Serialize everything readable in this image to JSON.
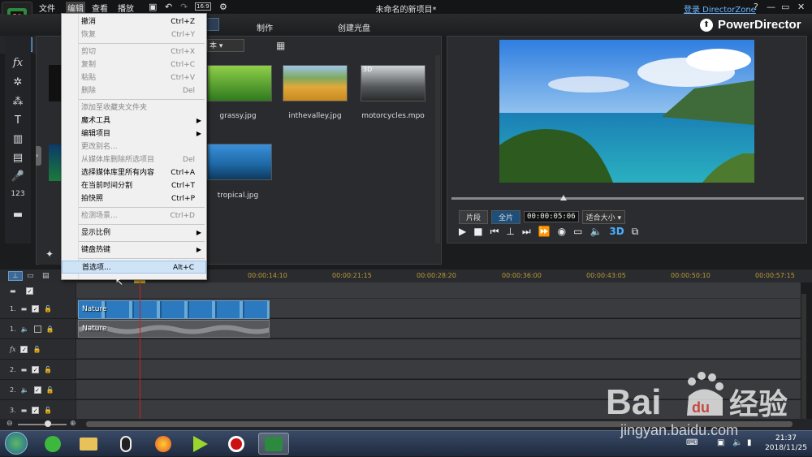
{
  "menubar": {
    "items": [
      "文件",
      "编辑",
      "查看",
      "播放"
    ],
    "aspect_badge": "16:9"
  },
  "window": {
    "project_title": "未命名的新项目*",
    "directorzone_link": "登录 DirectorZone",
    "help": "?",
    "minimize": "—",
    "restore": "▭",
    "close": "✕"
  },
  "modes": [
    "制作",
    "创建光盘"
  ],
  "brand": "PowerDirector",
  "library": {
    "media": [
      {
        "name": "grassy.jpg",
        "colors": [
          "#6fb83a",
          "#2f6a1d"
        ]
      },
      {
        "name": "inthevalley.jpg",
        "colors": [
          "#d9a53a",
          "#6b8e3a"
        ]
      },
      {
        "name": "motorcycles.mpo",
        "colors": [
          "#9aa0a3",
          "#3a3a3a"
        ],
        "badge": "3D"
      },
      {
        "name": "tropical.jpg",
        "colors": [
          "#2a7bbf",
          "#164a6e"
        ]
      }
    ],
    "filter_dropdown": "本"
  },
  "edit_menu": {
    "groups": [
      [
        {
          "label": "撤消",
          "shortcut": "Ctrl+Z",
          "disabled": false
        },
        {
          "label": "恢复",
          "shortcut": "Ctrl+Y",
          "disabled": true
        }
      ],
      [
        {
          "label": "剪切",
          "shortcut": "Ctrl+X",
          "disabled": true
        },
        {
          "label": "复制",
          "shortcut": "Ctrl+C",
          "disabled": true
        },
        {
          "label": "粘贴",
          "shortcut": "Ctrl+V",
          "disabled": true
        },
        {
          "label": "删除",
          "shortcut": "Del",
          "disabled": true
        }
      ],
      [
        {
          "label": "添加至收藏夹文件夹",
          "shortcut": "",
          "disabled": true
        },
        {
          "label": "魔术工具",
          "shortcut": "",
          "disabled": false,
          "submenu": true
        },
        {
          "label": "编辑项目",
          "shortcut": "",
          "disabled": false,
          "submenu": true
        },
        {
          "label": "更改别名...",
          "shortcut": "",
          "disabled": true
        },
        {
          "label": "从媒体库删除所选项目",
          "shortcut": "Del",
          "disabled": true
        },
        {
          "label": "选择媒体库里所有内容",
          "shortcut": "Ctrl+A",
          "disabled": false
        },
        {
          "label": "在当前时间分割",
          "shortcut": "Ctrl+T",
          "disabled": false
        },
        {
          "label": "拍快照",
          "shortcut": "Ctrl+P",
          "disabled": false
        }
      ],
      [
        {
          "label": "检测场景...",
          "shortcut": "Ctrl+D",
          "disabled": true
        }
      ],
      [
        {
          "label": "显示比例",
          "shortcut": "",
          "disabled": false,
          "submenu": true
        }
      ],
      [
        {
          "label": "键盘热键",
          "shortcut": "",
          "disabled": false,
          "submenu": true
        }
      ],
      [
        {
          "label": "首选项...",
          "shortcut": "Alt+C",
          "disabled": false,
          "hover": true
        }
      ]
    ]
  },
  "preview": {
    "segment_label": "片段",
    "full_label": "全片",
    "timecode": "00:00:05:06",
    "fit_label": "适合大小",
    "stereo_label": "3D"
  },
  "timeline": {
    "ruler_ticks": [
      "00:00:14:10",
      "00:00:21:15",
      "00:00:28:20",
      "00:00:36:00",
      "00:00:43:05",
      "00:00:50:10",
      "00:00:57:15"
    ],
    "tracks": [
      {
        "num": "",
        "kind": "master",
        "locked": false
      },
      {
        "num": "1.",
        "kind": "video",
        "locked": false
      },
      {
        "num": "1.",
        "kind": "audio",
        "locked": true
      },
      {
        "num": "",
        "kind": "fx",
        "locked": false
      },
      {
        "num": "2.",
        "kind": "video",
        "locked": false
      },
      {
        "num": "2.",
        "kind": "audio",
        "locked": false
      },
      {
        "num": "3.",
        "kind": "video",
        "locked": false
      }
    ],
    "video_clip_label": "Nature",
    "audio_clip_label": "Nature"
  },
  "taskbar": {
    "time": "21:37",
    "date": "2018/11/25"
  },
  "watermark": {
    "brand": "Bai",
    "paw": "du",
    "cn": "经验",
    "url": "jingyan.baidu.com"
  }
}
